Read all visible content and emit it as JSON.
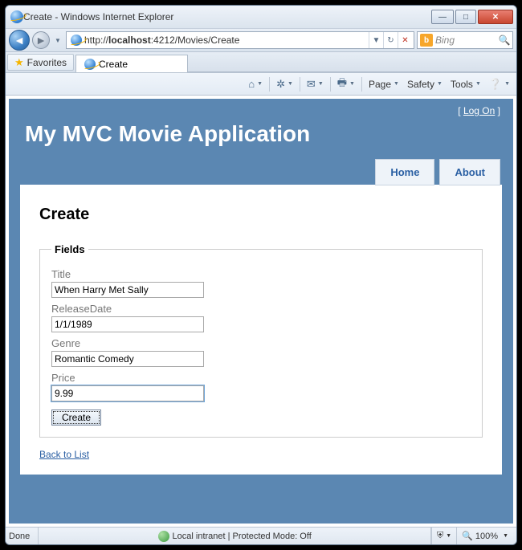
{
  "window": {
    "title": "Create - Windows Internet Explorer"
  },
  "nav": {
    "url_prefix": "http://",
    "url_host": "localhost",
    "url_rest": ":4212/Movies/Create",
    "search_placeholder": "Bing"
  },
  "favorites": {
    "label": "Favorites"
  },
  "tab": {
    "title": "Create"
  },
  "cmdbar": {
    "page": "Page",
    "safety": "Safety",
    "tools": "Tools"
  },
  "logon": {
    "open": "[ ",
    "text": "Log On",
    "close": " ]"
  },
  "app": {
    "title": "My MVC Movie Application"
  },
  "menu": {
    "home": "Home",
    "about": "About"
  },
  "page": {
    "heading": "Create",
    "legend": "Fields",
    "labels": {
      "title": "Title",
      "releaseDate": "ReleaseDate",
      "genre": "Genre",
      "price": "Price"
    },
    "values": {
      "title": "When Harry Met Sally",
      "releaseDate": "1/1/1989",
      "genre": "Romantic Comedy",
      "price": "9.99"
    },
    "submit": "Create",
    "back": "Back to List"
  },
  "status": {
    "done": "Done",
    "zone": "Local intranet | Protected Mode: Off",
    "zoom": "100%"
  }
}
